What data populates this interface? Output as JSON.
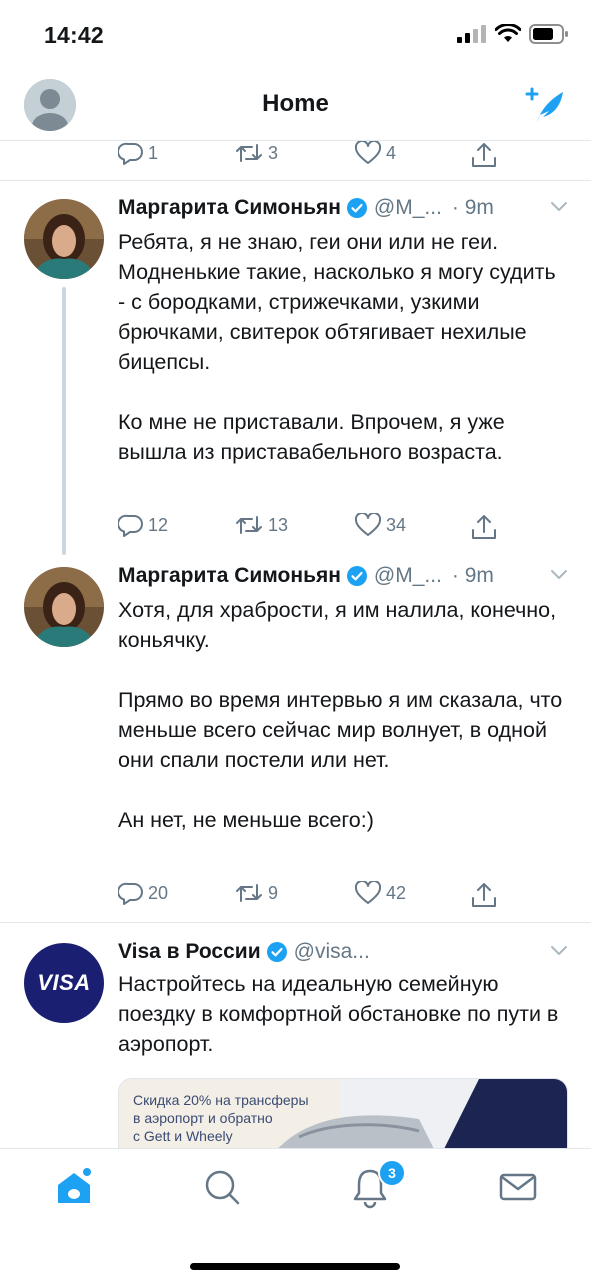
{
  "status_bar": {
    "time": "14:42"
  },
  "header": {
    "title": "Home"
  },
  "colors": {
    "accent": "#1da1f2",
    "text": "#14171a",
    "secondary": "#657786",
    "divider": "#e1e8ed",
    "visa_blue": "#1a1f71"
  },
  "icons": [
    "avatar",
    "compose-icon",
    "reply-icon",
    "retweet-icon",
    "like-icon",
    "share-icon",
    "verified-badge-icon",
    "caret-down-icon",
    "home-icon",
    "search-icon",
    "notifications-icon",
    "messages-icon"
  ],
  "tweets": [
    {
      "partial": true,
      "replies": "1",
      "retweets": "3",
      "likes": "4"
    },
    {
      "name": "Маргарита Симоньян",
      "handle": "@M_...",
      "time": "· 9m",
      "text": "Ребята, я не знаю, геи они или не геи. Модненькие такие, насколько я могу судить - с бородками, стрижечками, узкими брючками, свитерок обтягивает нехилые бицепсы.\n\nКо мне не приставали. Впрочем, я уже вышла из приставабельного возраста.",
      "replies": "12",
      "retweets": "13",
      "likes": "34"
    },
    {
      "name": "Маргарита Симоньян",
      "handle": "@M_...",
      "time": "· 9m",
      "text": "Хотя, для храбрости, я им налила, конечно, коньячку.\n\nПрямо во время интервью я им сказала, что меньше всего сейчас мир волнует, в одной они спали постели или нет.\n\nАн нет, не меньше всего:)",
      "replies": "20",
      "retweets": "9",
      "likes": "42"
    },
    {
      "name": "Visa в России",
      "handle": "@visa...",
      "avatar_text": "VISA",
      "text": "Настройтесь на идеальную семейную поездку в комфортной обстановке по пути в аэропорт.",
      "card_text": "Скидка 20% на трансферы\nв аэропорт и обратно\nс Gett и Wheely"
    }
  ],
  "tab_bar": {
    "notifications_badge": "3"
  }
}
